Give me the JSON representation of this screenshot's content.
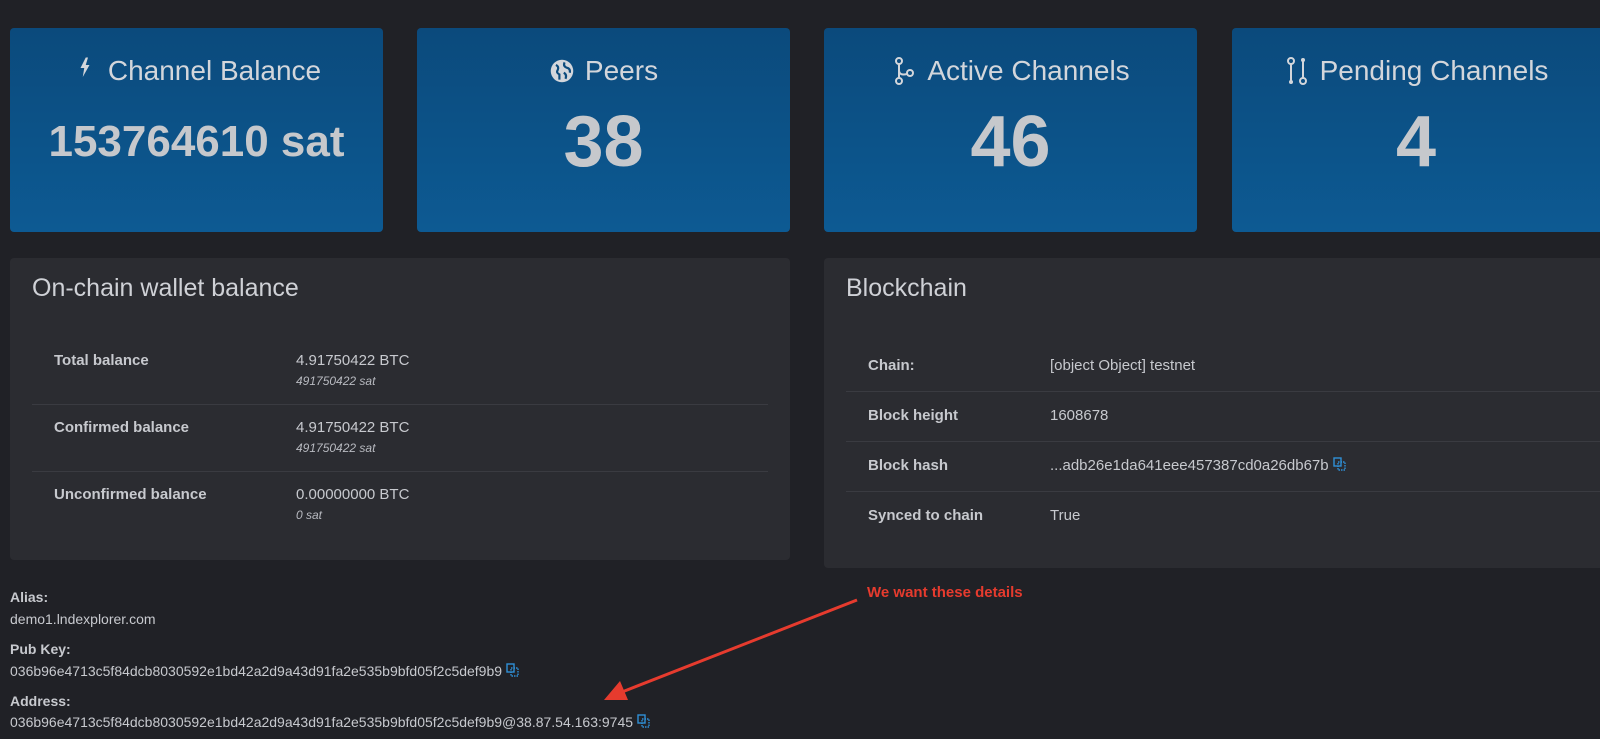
{
  "stats": [
    {
      "title": "Channel Balance",
      "value": "153764610 sat",
      "icon": "lightning-icon"
    },
    {
      "title": "Peers",
      "value": "38",
      "icon": "globe-icon"
    },
    {
      "title": "Active Channels",
      "value": "46",
      "icon": "git-branch-icon"
    },
    {
      "title": "Pending Channels",
      "value": "4",
      "icon": "git-compare-icon"
    }
  ],
  "wallet": {
    "title": "On-chain wallet balance",
    "rows": [
      {
        "label": "Total balance",
        "btc": "4.91750422 BTC",
        "sat": "491750422 sat"
      },
      {
        "label": "Confirmed balance",
        "btc": "4.91750422 BTC",
        "sat": "491750422 sat"
      },
      {
        "label": "Unconfirmed balance",
        "btc": "0.00000000 BTC",
        "sat": "0 sat"
      }
    ]
  },
  "blockchain": {
    "title": "Blockchain",
    "rows": [
      {
        "label": "Chain:",
        "value": "[object Object] testnet"
      },
      {
        "label": "Block height",
        "value": "1608678"
      },
      {
        "label": "Block hash",
        "value": "...adb26e1da641eee457387cd0a26db67b"
      },
      {
        "label": "Synced to chain",
        "value": "True"
      }
    ]
  },
  "node": {
    "alias_label": "Alias:",
    "alias": "demo1.lndexplorer.com",
    "pubkey_label": "Pub Key:",
    "pubkey": "036b96e4713c5f84dcb8030592e1bd42a2d9a43d91fa2e535b9bfd05f2c5def9b9",
    "address_label": "Address:",
    "address": "036b96e4713c5f84dcb8030592e1bd42a2d9a43d91fa2e535b9bfd05f2c5def9b9@38.87.54.163:9745"
  },
  "annotation": {
    "text": "We want these details",
    "color": "#e63b2e"
  },
  "colors": {
    "background": "#202126",
    "card": "#0c5288",
    "panel": "#2b2c31",
    "copy_icon": "#2f8fd6"
  }
}
